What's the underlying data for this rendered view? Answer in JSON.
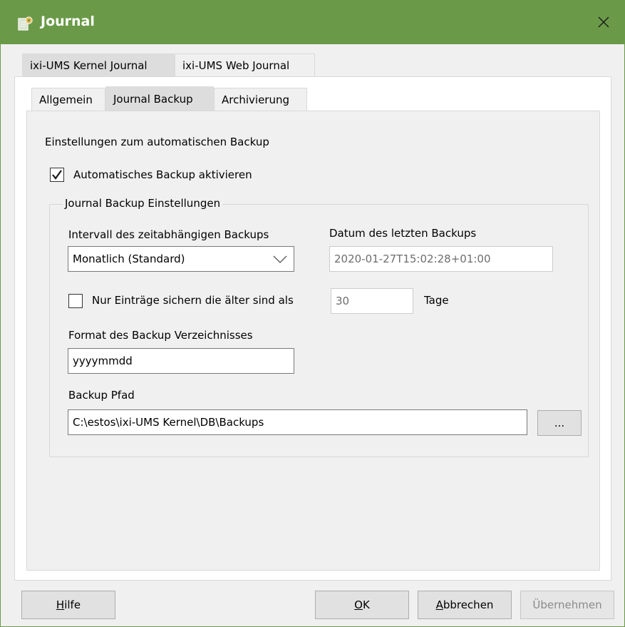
{
  "window": {
    "title": "Journal",
    "title_icon": "journal-gear-icon",
    "close_icon": "close-icon"
  },
  "outer_tabs": [
    {
      "label": "ixi-UMS Kernel Journal",
      "active": true
    },
    {
      "label": "ixi-UMS Web Journal",
      "active": false
    }
  ],
  "inner_tabs": [
    {
      "label": "Allgemein",
      "active": false
    },
    {
      "label": "Journal Backup",
      "active": true
    },
    {
      "label": "Archivierung",
      "active": false
    }
  ],
  "content": {
    "heading": "Einstellungen zum automatischen Backup",
    "auto_backup": {
      "label": "Automatisches Backup aktivieren",
      "checked": true
    },
    "group_title": "Journal Backup Einstellungen",
    "interval": {
      "label": "Intervall des zeitabhängigen Backups",
      "value": "Monatlich (Standard)"
    },
    "last_backup": {
      "label": "Datum des letzten Backups",
      "value": "2020-01-27T15:02:28+01:00"
    },
    "older_than": {
      "label": "Nur Einträge sichern die älter sind als",
      "checked": false,
      "value": "30",
      "unit": "Tage"
    },
    "dir_format": {
      "label": "Format des Backup Verzeichnisses",
      "value": "yyyymmdd"
    },
    "backup_path": {
      "label": "Backup Pfad",
      "value": "C:\\estos\\ixi-UMS Kernel\\DB\\Backups",
      "browse_label": "..."
    }
  },
  "buttons": {
    "help": {
      "first": "H",
      "rest": "ilfe"
    },
    "ok": {
      "first": "O",
      "rest": "K"
    },
    "cancel": {
      "first": "A",
      "rest": "bbrechen"
    },
    "apply": "Übernehmen"
  },
  "colors": {
    "titlebar": "#6a9a48",
    "active_tab": "#dddddd",
    "dialog_bg": "#f0f0f0"
  }
}
